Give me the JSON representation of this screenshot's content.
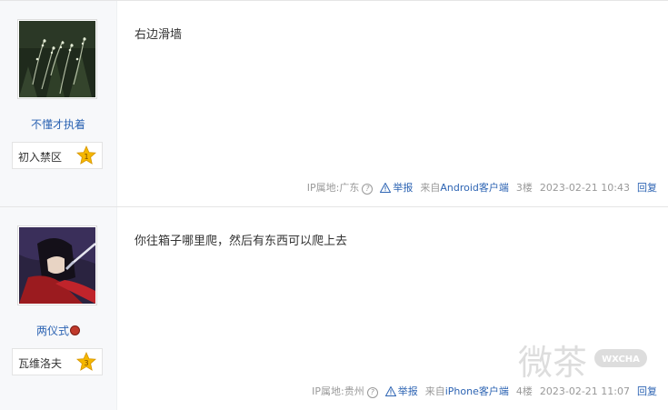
{
  "posts": [
    {
      "username": "不懂才执着",
      "badge_label": "初入禁区",
      "badge_level": "1",
      "content": "右边滑墙",
      "ip_label": "IP属地:广东",
      "report_label": "举报",
      "source_prefix": "来自",
      "source_client": "Android客户端",
      "floor": "3楼",
      "timestamp": "2023-02-21 10:43",
      "reply_label": "回复"
    },
    {
      "username": "两仪式",
      "badge_label": "瓦维洛夫",
      "badge_level": "3",
      "content": "你往箱子哪里爬，然后有东西可以爬上去",
      "ip_label": "IP属地:贵州",
      "report_label": "举报",
      "source_prefix": "来自",
      "source_client": "iPhone客户端",
      "floor": "4楼",
      "timestamp": "2023-02-21 11:07",
      "reply_label": "回复"
    }
  ],
  "watermark": {
    "text_cn": "微茶",
    "text_en": "WXCHA"
  },
  "colors": {
    "link": "#2d64b3",
    "meta": "#999999",
    "sidebar_bg": "#f7f8fa",
    "star": "#f5b700"
  }
}
